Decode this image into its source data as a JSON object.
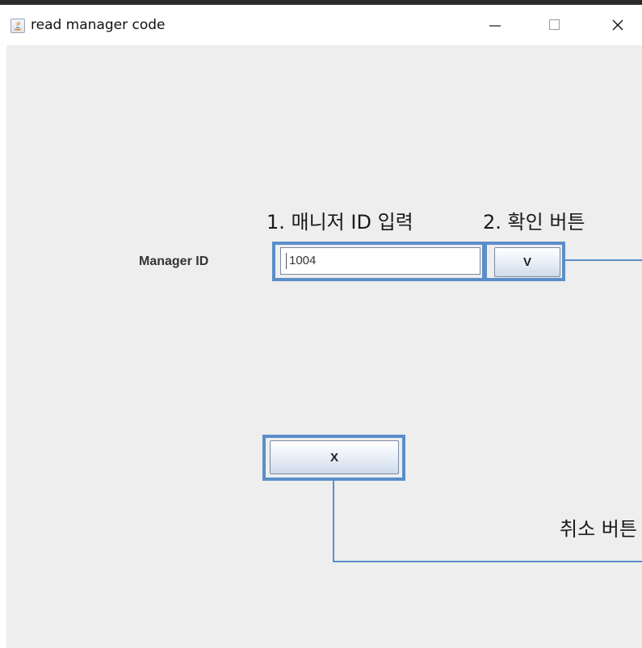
{
  "window": {
    "title": "read manager code",
    "controls": {
      "minimize": "—",
      "maximize": "□",
      "close": "✕"
    }
  },
  "annotations": {
    "step1": "1. 매니저 ID 입력",
    "step2": "2. 확인 버튼",
    "cancel": "취소 버튼"
  },
  "form": {
    "manager_id_label": "Manager ID",
    "manager_id_value": "1004",
    "ok_label": "V",
    "cancel_label": "X"
  },
  "colors": {
    "highlight": "#5b8ec9",
    "background": "#eeeeee"
  },
  "icons": [
    "java-app-icon",
    "minimize-icon",
    "maximize-icon",
    "close-icon"
  ]
}
